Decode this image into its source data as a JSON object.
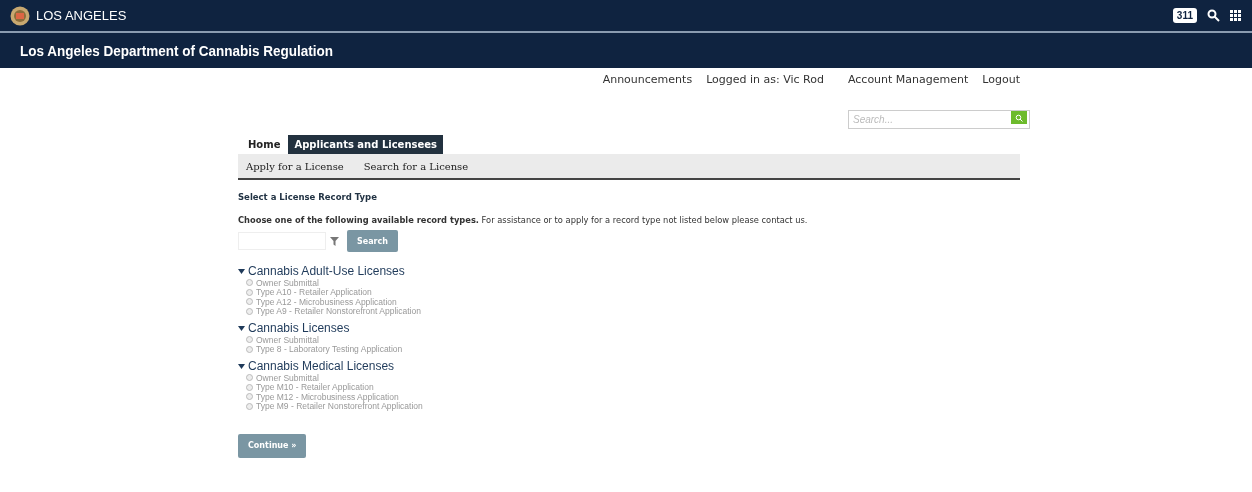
{
  "top_bar": {
    "brand": "LOS ANGELES",
    "badge": "311"
  },
  "header": {
    "title": "Los Angeles Department of Cannabis Regulation"
  },
  "user_links": [
    {
      "kind": "link",
      "label": "Announcements"
    },
    {
      "kind": "text",
      "label": "Logged in as: Vic Rod"
    },
    {
      "kind": "link",
      "label": "Account Management"
    },
    {
      "kind": "link",
      "label": "Logout"
    }
  ],
  "site_search": {
    "placeholder": "Search..."
  },
  "tabs": [
    {
      "label": "Home",
      "selected": false
    },
    {
      "label": "Applicants and Licensees",
      "selected": true
    }
  ],
  "sub_nav": [
    "Apply for a License",
    "Search for a License"
  ],
  "section_title": "Select a License Record Type",
  "instructions": "**Choose one of the following available record types.** For assistance or to apply for a record type not listed below please contact us.",
  "filter": {
    "button": "Search"
  },
  "groups": [
    {
      "title": "Cannabis Adult-Use Licenses",
      "expanded": true,
      "options": [
        {
          "label": "Owner Submittal",
          "selected": false
        },
        {
          "label": "Type A10 - Retailer Application",
          "selected": false
        },
        {
          "label": "Type A12 - Microbusiness Application",
          "selected": false
        },
        {
          "label": "Type A9 - Retailer Nonstorefront Application",
          "selected": false
        }
      ]
    },
    {
      "title": "Cannabis Licenses",
      "expanded": true,
      "options": [
        {
          "label": "Owner Submittal",
          "selected": false
        },
        {
          "label": "Type 8 - Laboratory Testing Application",
          "selected": false
        }
      ]
    },
    {
      "title": "Cannabis Medical Licenses",
      "expanded": true,
      "options": [
        {
          "label": "Owner Submittal",
          "selected": false
        },
        {
          "label": "Type M10 - Retailer Application",
          "selected": false
        },
        {
          "label": "Type M12 - Microbusiness Application",
          "selected": false
        },
        {
          "label": "Type M9 - Retailer Nonstorefront Application",
          "selected": false
        }
      ]
    }
  ],
  "continue_button": "Continue »"
}
